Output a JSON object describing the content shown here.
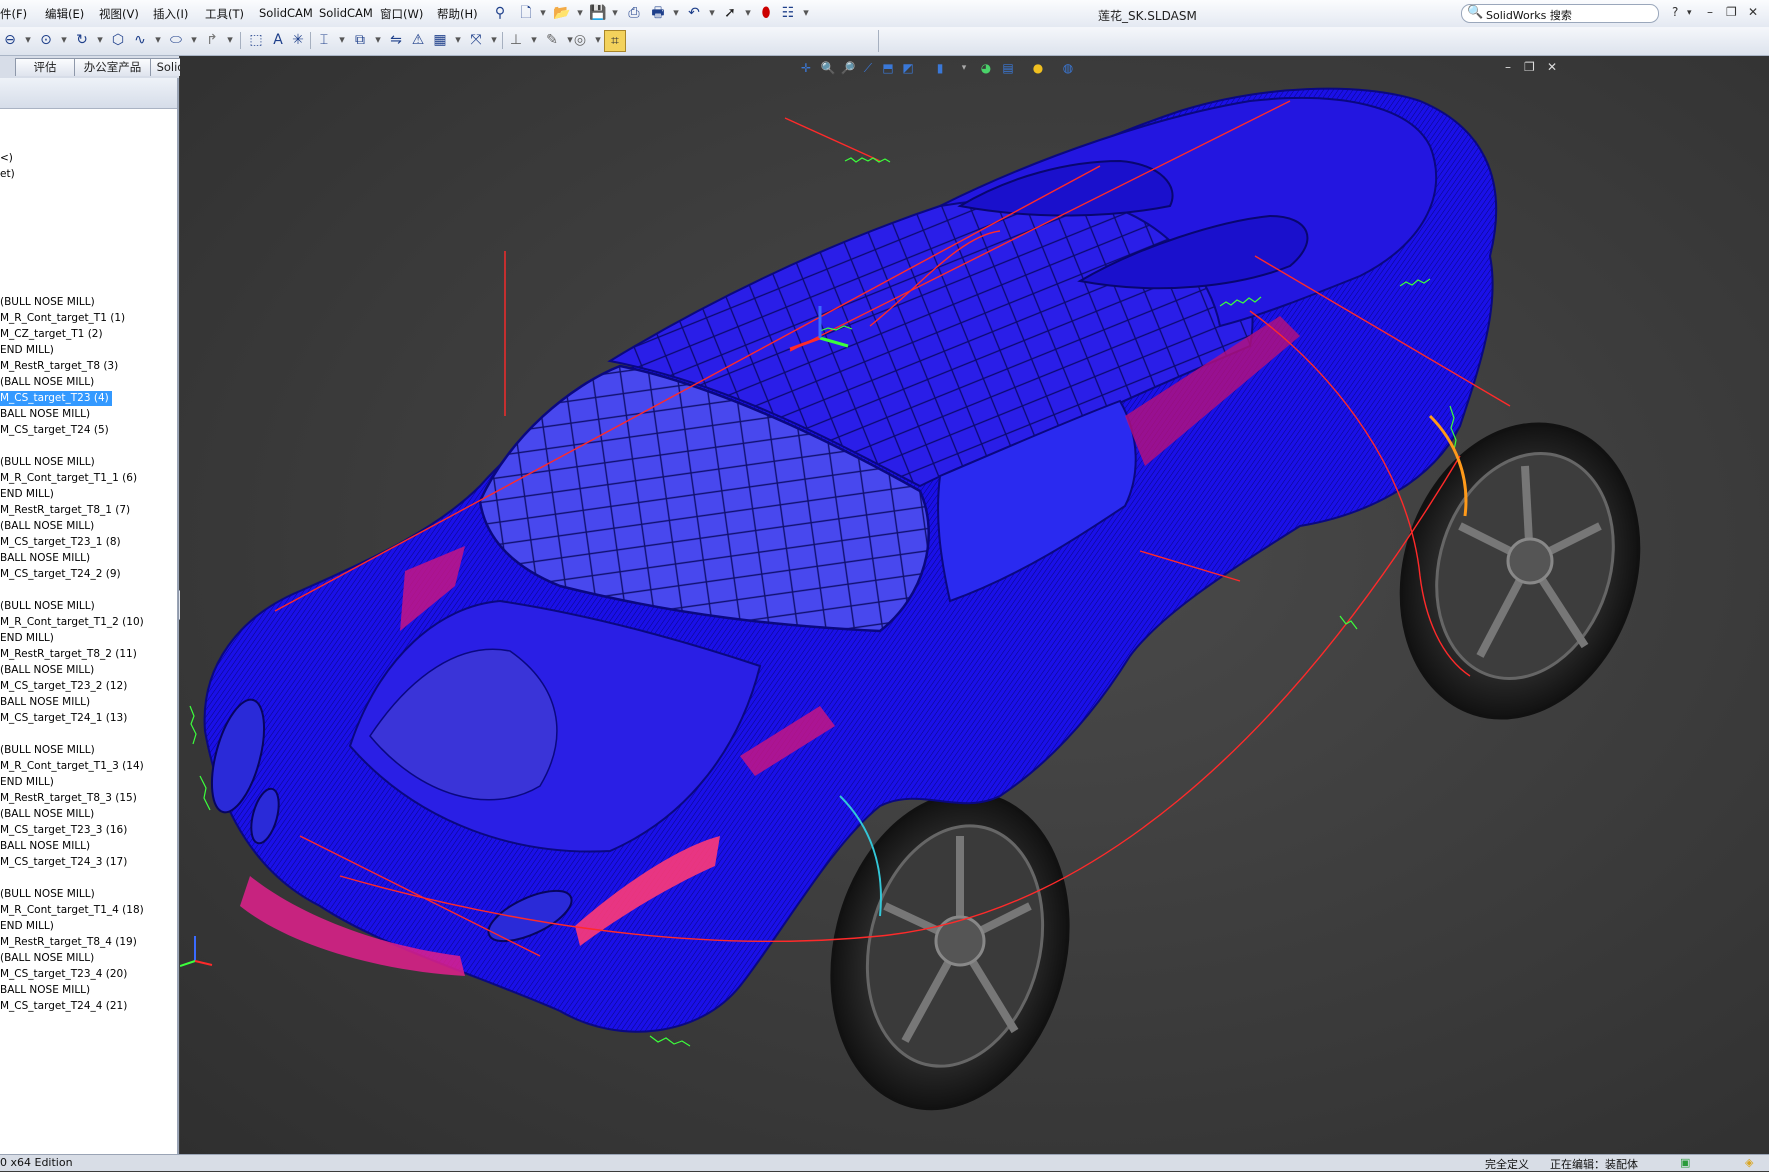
{
  "menubar": {
    "items": [
      "件(F)",
      "编辑(E)",
      "视图(V)",
      "插入(I)",
      "工具(T)",
      "SolidCAM",
      "SolidCAM",
      "窗口(W)",
      "帮助(H)"
    ],
    "doc_title": "莲花_SK.SLDASM",
    "search_label": "SolidWorks 搜索",
    "help_glyph": "?",
    "minimize_glyph": "–",
    "restore_glyph": "❐",
    "close_glyph": "✕"
  },
  "command_tabs": [
    "评估",
    "办公室产品",
    "SolidCAM"
  ],
  "tree": {
    "items": [
      {
        "label": "<)",
        "selected": false
      },
      {
        "label": "et)",
        "selected": false
      },
      {
        "label": "(BULL NOSE MILL)",
        "selected": false
      },
      {
        "label": "M_R_Cont_target_T1 (1)",
        "selected": false
      },
      {
        "label": "M_CZ_target_T1 (2)",
        "selected": false
      },
      {
        "label": "END MILL)",
        "selected": false
      },
      {
        "label": "M_RestR_target_T8 (3)",
        "selected": false
      },
      {
        "label": " (BALL NOSE MILL)",
        "selected": false
      },
      {
        "label": "M_CS_target_T23 (4)",
        "selected": true
      },
      {
        "label": "BALL NOSE MILL)",
        "selected": false
      },
      {
        "label": "M_CS_target_T24 (5)",
        "selected": false
      },
      {
        "label": "(BULL NOSE MILL)",
        "selected": false
      },
      {
        "label": "M_R_Cont_target_T1_1 (6)",
        "selected": false
      },
      {
        "label": "END MILL)",
        "selected": false
      },
      {
        "label": "M_RestR_target_T8_1 (7)",
        "selected": false
      },
      {
        "label": " (BALL NOSE MILL)",
        "selected": false
      },
      {
        "label": "M_CS_target_T23_1 (8)",
        "selected": false
      },
      {
        "label": "BALL NOSE MILL)",
        "selected": false
      },
      {
        "label": "M_CS_target_T24_2 (9)",
        "selected": false
      },
      {
        "label": "(BULL NOSE MILL)",
        "selected": false
      },
      {
        "label": "M_R_Cont_target_T1_2 (10)",
        "selected": false
      },
      {
        "label": "END MILL)",
        "selected": false
      },
      {
        "label": "M_RestR_target_T8_2 (11)",
        "selected": false
      },
      {
        "label": " (BALL NOSE MILL)",
        "selected": false
      },
      {
        "label": "M_CS_target_T23_2 (12)",
        "selected": false
      },
      {
        "label": "BALL NOSE MILL)",
        "selected": false
      },
      {
        "label": "M_CS_target_T24_1 (13)",
        "selected": false
      },
      {
        "label": "(BULL NOSE MILL)",
        "selected": false
      },
      {
        "label": "M_R_Cont_target_T1_3 (14)",
        "selected": false
      },
      {
        "label": "END MILL)",
        "selected": false
      },
      {
        "label": "M_RestR_target_T8_3 (15)",
        "selected": false
      },
      {
        "label": " (BALL NOSE MILL)",
        "selected": false
      },
      {
        "label": "M_CS_target_T23_3 (16)",
        "selected": false
      },
      {
        "label": "BALL NOSE MILL)",
        "selected": false
      },
      {
        "label": "M_CS_target_T24_3 (17)",
        "selected": false
      },
      {
        "label": "(BULL NOSE MILL)",
        "selected": false
      },
      {
        "label": "M_R_Cont_target_T1_4 (18)",
        "selected": false
      },
      {
        "label": "END MILL)",
        "selected": false
      },
      {
        "label": "M_RestR_target_T8_4 (19)",
        "selected": false
      },
      {
        "label": " (BALL NOSE MILL)",
        "selected": false
      },
      {
        "label": "M_CS_target_T23_4 (20)",
        "selected": false
      },
      {
        "label": "BALL NOSE MILL)",
        "selected": false
      },
      {
        "label": "M_CS_target_T24_4 (21)",
        "selected": false
      }
    ]
  },
  "statusbar": {
    "edition": "0 x64 Edition",
    "status": "完全定义",
    "editing": "正在编辑：装配体"
  },
  "colors": {
    "car_body": "#1a10e8",
    "car_body_dark": "#0b0890",
    "toolpath_red": "#ff2a2a",
    "toolpath_green": "#3cff3c",
    "toolpath_magenta": "#ff2d8c",
    "selection": "#3399ff",
    "viewport_bg": "#3d3d3d"
  }
}
